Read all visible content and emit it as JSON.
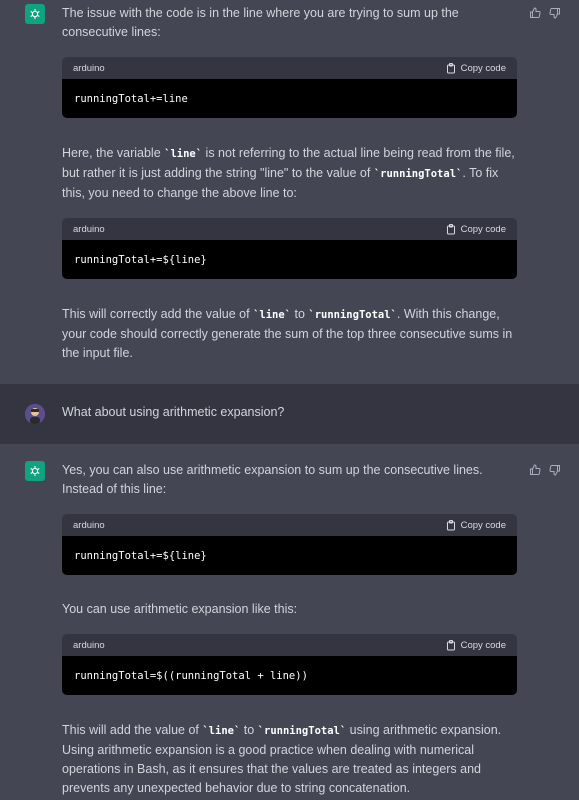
{
  "messages": {
    "m1": {
      "p1": "The issue with the code is in the line where you are trying to sum up the consecutive lines:",
      "code1": {
        "lang": "arduino",
        "copy": "Copy code",
        "code": "runningTotal+=line"
      },
      "p2a": "Here, the variable ",
      "p2code1": "`line`",
      "p2b": " is not referring to the actual line being read from the file, but rather it is just adding the string \"line\" to the value of ",
      "p2code2": "`runningTotal`",
      "p2c": ". To fix this, you need to change the above line to:",
      "code2": {
        "lang": "arduino",
        "copy": "Copy code",
        "code": "runningTotal+=${line}"
      },
      "p3a": "This will correctly add the value of ",
      "p3code1": "`line`",
      "p3b": " to ",
      "p3code2": "`runningTotal`",
      "p3c": ". With this change, your code should correctly generate the sum of the top three consecutive sums in the input file."
    },
    "m2": {
      "text": "What about using arithmetic expansion?"
    },
    "m3": {
      "p1": "Yes, you can also use arithmetic expansion to sum up the consecutive lines. Instead of this line:",
      "code1": {
        "lang": "arduino",
        "copy": "Copy code",
        "code": "runningTotal+=${line}"
      },
      "p2": "You can use arithmetic expansion like this:",
      "code2": {
        "lang": "arduino",
        "copy": "Copy code",
        "code": "runningTotal=$((runningTotal + line))"
      },
      "p3a": "This will add the value of ",
      "p3code1": "`line`",
      "p3b": " to ",
      "p3code2": "`runningTotal`",
      "p3c": " using arithmetic expansion. Using arithmetic expansion is a good practice when dealing with numerical operations in Bash, as it ensures that the values are treated as integers and prevents any unexpected behavior due to string concatenation."
    }
  }
}
